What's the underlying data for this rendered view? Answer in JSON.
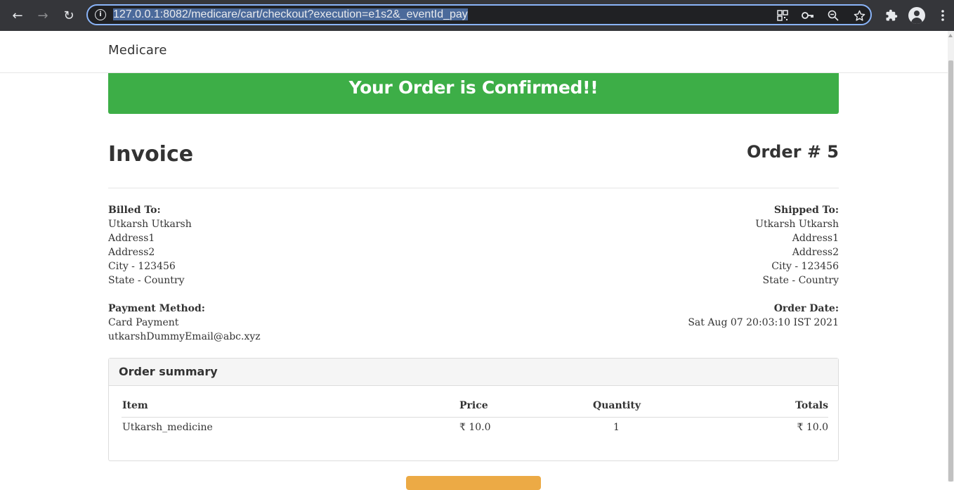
{
  "browser": {
    "url_highlight": "127.0.0.1:8082/medicare/cart/checkout?execution=e1s2&_eventId_pay",
    "back_glyph": "←",
    "forward_glyph": "→",
    "reload_glyph": "↻",
    "info_glyph": "i",
    "icons": [
      "qr-code-icon",
      "key-icon",
      "zoom-icon",
      "star-icon",
      "extensions-icon",
      "profile-icon",
      "menu-icon"
    ]
  },
  "navbar": {
    "brand": "Medicare"
  },
  "banner": {
    "message": "Your Order is Confirmed!!",
    "color": "#3dae47"
  },
  "invoice": {
    "title": "Invoice",
    "order_number": "Order # 5"
  },
  "billed": {
    "label": "Billed To:",
    "name": "Utkarsh Utkarsh",
    "address1": "Address1",
    "address2": "Address2",
    "city": "City - 123456",
    "state": "State - Country"
  },
  "shipped": {
    "label": "Shipped To:",
    "name": "Utkarsh Utkarsh",
    "address1": "Address1",
    "address2": "Address2",
    "city": "City - 123456",
    "state": "State - Country"
  },
  "payment": {
    "label": "Payment Method:",
    "method": "Card Payment",
    "email": "utkarshDummyEmail@abc.xyz"
  },
  "order_date": {
    "label": "Order Date:",
    "value": "Sat Aug 07 20:03:10 IST 2021"
  },
  "summary": {
    "title": "Order summary",
    "headers": {
      "item": "Item",
      "price": "Price",
      "quantity": "Quantity",
      "totals": "Totals"
    },
    "rows": [
      {
        "item": "Utkarsh_medicine",
        "price": "₹ 10.0",
        "quantity": "1",
        "totals": "₹ 10.0"
      }
    ]
  },
  "colors": {
    "accent_button": "#ecaa45",
    "omnibox_border": "#8ab4f8"
  }
}
